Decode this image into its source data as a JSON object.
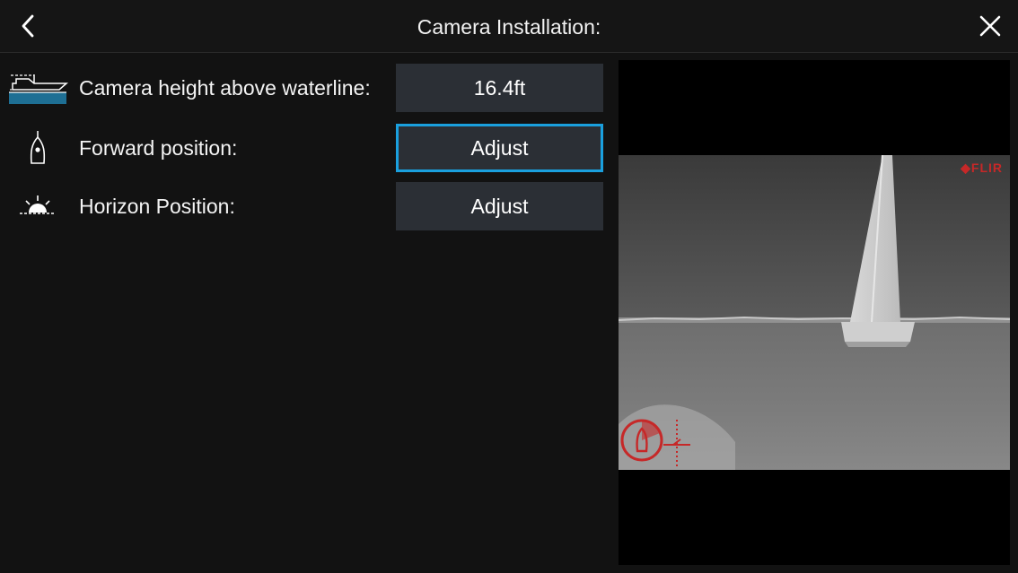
{
  "header": {
    "title": "Camera Installation:",
    "back_icon": "chevron-left-icon",
    "close_icon": "close-icon"
  },
  "settings": [
    {
      "icon": "boat-waterline-icon",
      "label": "Camera height above waterline:",
      "value": "16.4ft",
      "selected": false
    },
    {
      "icon": "boat-forward-icon",
      "label": "Forward position:",
      "value": "Adjust",
      "selected": true
    },
    {
      "icon": "horizon-sunrise-icon",
      "label": "Horizon Position:",
      "value": "Adjust",
      "selected": false
    }
  ],
  "preview": {
    "brand_label": "FLIR",
    "content": "thermal camera view of sailboat"
  },
  "colors": {
    "background": "#121212",
    "button": "#2b2f35",
    "selection_border": "#1aa0de",
    "waterline": "#1e6f94",
    "brand": "#c62828"
  }
}
